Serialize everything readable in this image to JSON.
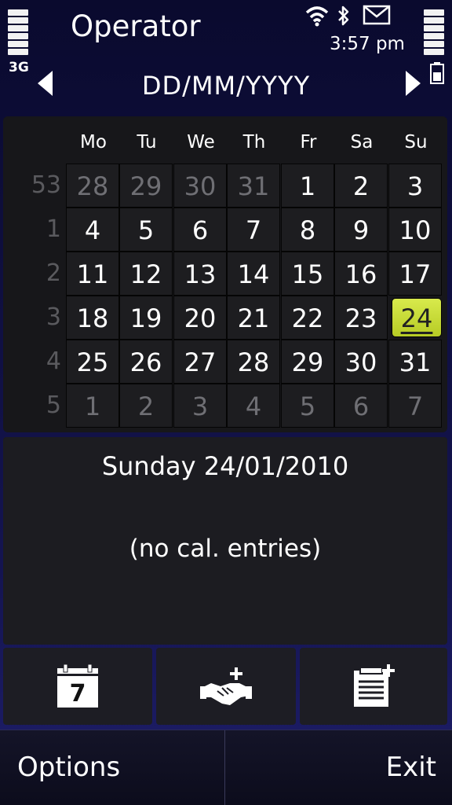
{
  "status": {
    "operator": "Operator",
    "network": "3G",
    "time": "3:57 pm",
    "icons": [
      "signal-strength-icon",
      "wifi-icon",
      "bluetooth-icon",
      "message-envelope-icon",
      "battery-level-icon",
      "battery-icon"
    ]
  },
  "nav": {
    "date_format": "DD/MM/YYYY",
    "prev_icon": "left-arrow-icon",
    "next_icon": "right-arrow-icon"
  },
  "calendar": {
    "weekdays": [
      "Mo",
      "Tu",
      "We",
      "Th",
      "Fr",
      "Sa",
      "Su"
    ],
    "weeks": [
      {
        "num": "53",
        "days": [
          "28",
          "29",
          "30",
          "31",
          "1",
          "2",
          "3"
        ]
      },
      {
        "num": "1",
        "days": [
          "4",
          "5",
          "6",
          "7",
          "8",
          "9",
          "10"
        ]
      },
      {
        "num": "2",
        "days": [
          "11",
          "12",
          "13",
          "14",
          "15",
          "16",
          "17"
        ]
      },
      {
        "num": "3",
        "days": [
          "18",
          "19",
          "20",
          "21",
          "22",
          "23",
          "24"
        ]
      },
      {
        "num": "4",
        "days": [
          "25",
          "26",
          "27",
          "28",
          "29",
          "30",
          "31"
        ]
      },
      {
        "num": "5",
        "days": [
          "1",
          "2",
          "3",
          "4",
          "5",
          "6",
          "7"
        ]
      }
    ],
    "selected_day": "24",
    "highlight_color": "#c6db36"
  },
  "day_panel": {
    "title": "Sunday 24/01/2010",
    "empty_text": "(no cal. entries)"
  },
  "toolbar": {
    "buttons": [
      {
        "icon": "calendar-day-view-icon",
        "text": "7"
      },
      {
        "icon": "new-meeting-icon"
      },
      {
        "icon": "new-todo-note-icon"
      }
    ]
  },
  "softkeys": {
    "left": "Options",
    "right": "Exit"
  }
}
